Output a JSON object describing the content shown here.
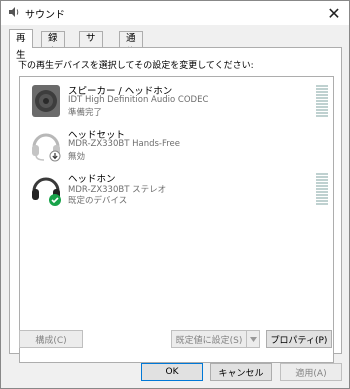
{
  "window": {
    "title": "サウンド",
    "close_label": "✕"
  },
  "tabs": [
    {
      "label": "再生",
      "active": true
    },
    {
      "label": "録音",
      "active": false
    },
    {
      "label": "サウンド",
      "active": false
    },
    {
      "label": "通信",
      "active": false
    }
  ],
  "instruction": "下の再生デバイスを選択してその設定を変更してください:",
  "devices": [
    {
      "name": "スピーカー / ヘッドホン",
      "description": "IDT High Definition Audio CODEC",
      "status": "準備完了",
      "icon": "speaker-icon"
    },
    {
      "name": "ヘッドセット",
      "description": "MDR-ZX330BT Hands-Free",
      "status": "無効",
      "icon": "headset-disabled-icon"
    },
    {
      "name": "ヘッドホン",
      "description": "MDR-ZX330BT ステレオ",
      "status": "既定のデバイス",
      "icon": "headphones-default-icon"
    }
  ],
  "buttons": {
    "configure": "構成(C)",
    "set_default": "既定値に設定(S)",
    "properties": "プロパティ(P)",
    "ok": "OK",
    "cancel": "キャンセル",
    "apply": "適用(A)"
  },
  "colors": {
    "accent": "#0078d7",
    "default_check": "#18a34a",
    "meter": "#bfd1d0"
  }
}
